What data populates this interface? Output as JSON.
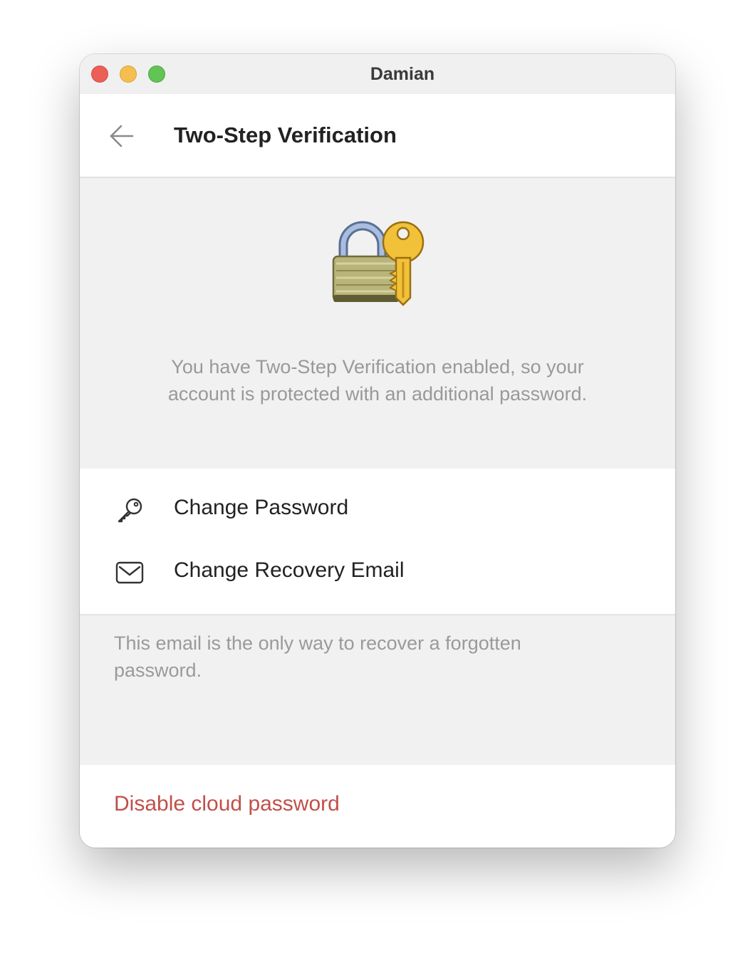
{
  "window": {
    "title": "Damian"
  },
  "header": {
    "title": "Two-Step Verification",
    "back_icon": "arrow-left-icon"
  },
  "hero": {
    "icon": "lock-with-key-icon",
    "description": "You have Two-Step Verification enabled, so your account is protected with an additional password."
  },
  "menu": {
    "items": [
      {
        "icon": "key-icon",
        "label": "Change Password"
      },
      {
        "icon": "envelope-icon",
        "label": "Change Recovery Email"
      }
    ]
  },
  "note": {
    "text": "This email is the only way to recover a forgotten password."
  },
  "danger": {
    "label": "Disable cloud password",
    "color": "#c24f4a"
  },
  "colors": {
    "traffic_close": "#ec5f57",
    "traffic_minimize": "#f4bf4f",
    "traffic_maximize": "#61c454",
    "background_gray": "#f1f1f1"
  }
}
